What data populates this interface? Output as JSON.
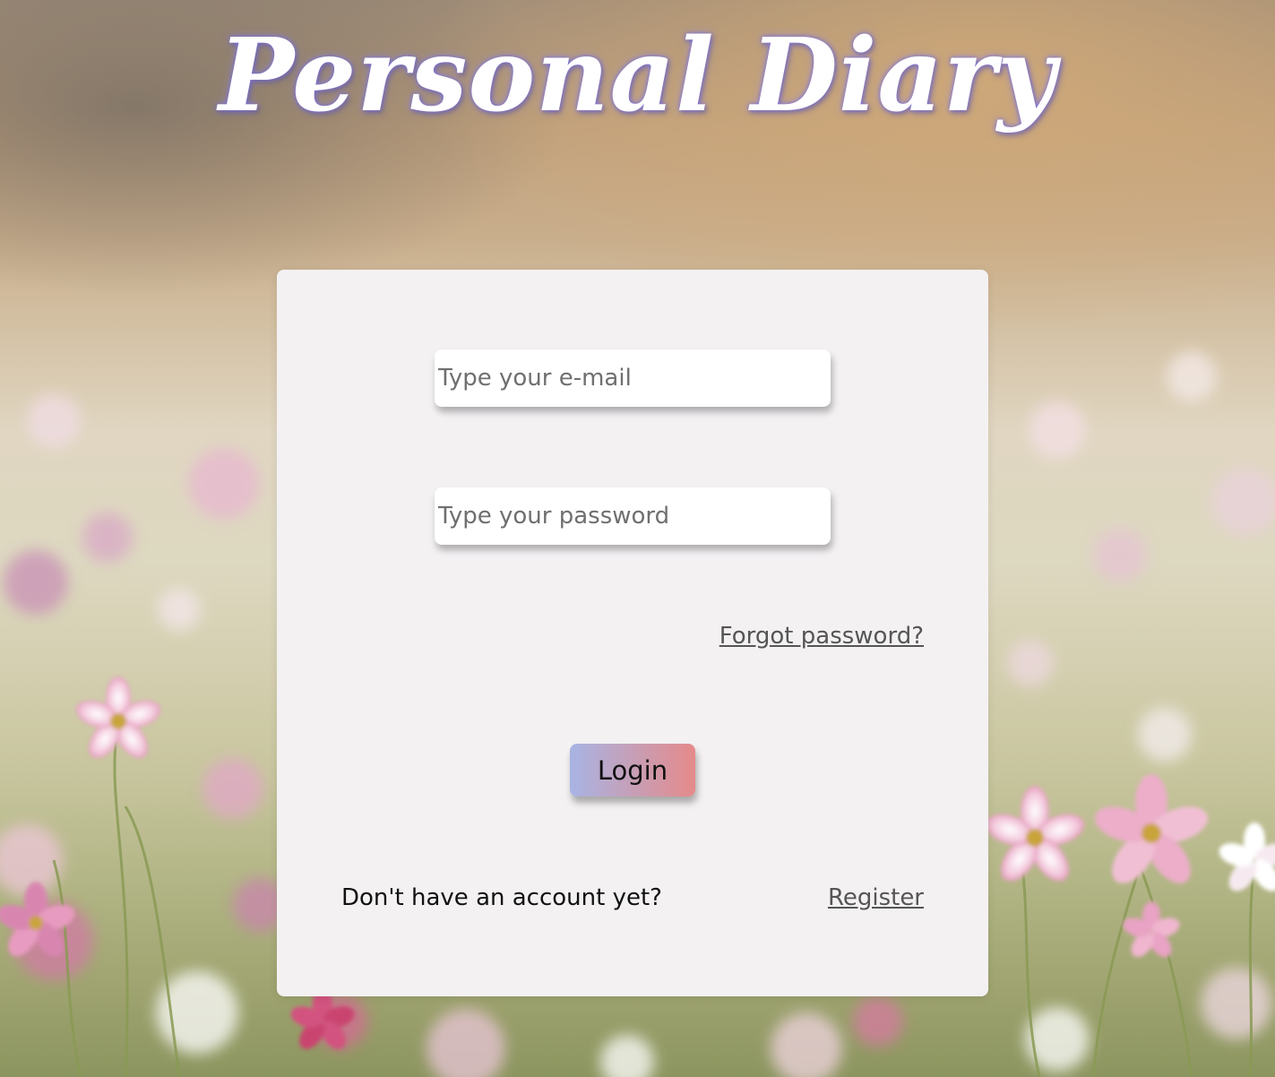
{
  "app": {
    "title": "Personal Diary"
  },
  "login_form": {
    "email_placeholder": "Type your e-mail",
    "email_value": "",
    "password_placeholder": "Type your password",
    "password_value": "",
    "forgot_password_label": "Forgot password?",
    "login_button_label": "Login",
    "no_account_text": "Don't have an account yet?",
    "register_label": "Register"
  },
  "colors": {
    "card_background": "#f3f1f2",
    "login_gradient_start": "#a8b4e4",
    "login_gradient_end": "#e58a8a",
    "link_color": "#555555",
    "title_color": "#ffffff",
    "title_glow": "#8c82e6"
  },
  "background": {
    "image_subject": "blurred cosmos flower field"
  }
}
